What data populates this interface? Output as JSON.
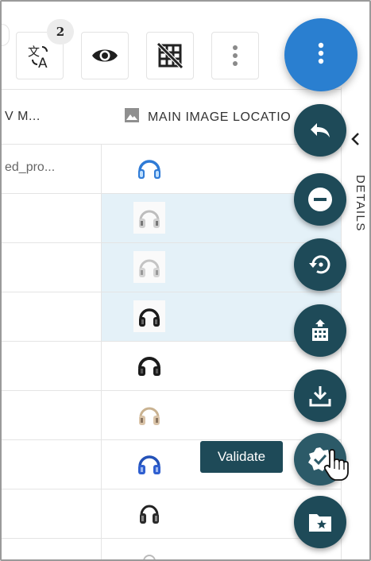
{
  "toolbar": {
    "translate_badge": "2",
    "buttons": [
      "translate-icon",
      "eye-icon",
      "grid-off-icon",
      "more-vert-icon"
    ]
  },
  "table": {
    "columns": [
      {
        "label": "V M...",
        "icon": null
      },
      {
        "label": "MAIN IMAGE LOCATIO",
        "icon": "image-icon"
      }
    ],
    "rows": [
      {
        "left": "ed_pro...",
        "thumb": "headphones-blue",
        "selected": false
      },
      {
        "left": "",
        "thumb": "headphones-silver",
        "selected": true
      },
      {
        "left": "",
        "thumb": "headphones-silver",
        "selected": true
      },
      {
        "left": "",
        "thumb": "headphones-black",
        "selected": true
      },
      {
        "left": "",
        "thumb": "headphones-black",
        "selected": false
      },
      {
        "left": "",
        "thumb": "headphones-beige",
        "selected": false
      },
      {
        "left": "",
        "thumb": "headphones-blue",
        "selected": false
      },
      {
        "left": "",
        "thumb": "headphones-black",
        "selected": false
      }
    ]
  },
  "details": {
    "label": "DETAILS"
  },
  "fabs": {
    "main": "more-vert-icon",
    "actions": [
      "undo-icon",
      "remove-circle-icon",
      "restore-icon",
      "building-icon",
      "download-icon",
      "verified-icon",
      "folder-star-icon"
    ]
  },
  "tooltip": {
    "text": "Validate"
  },
  "colors": {
    "fab_main": "#2a7fd0",
    "fab_secondary": "#1e4a58",
    "selected_row": "#e4f1f8",
    "headphones_blue": "#2f7bd6",
    "headphones_black": "#1b1b1b",
    "headphones_silver": "#cfcfcf",
    "headphones_beige": "#d9c3a8"
  }
}
